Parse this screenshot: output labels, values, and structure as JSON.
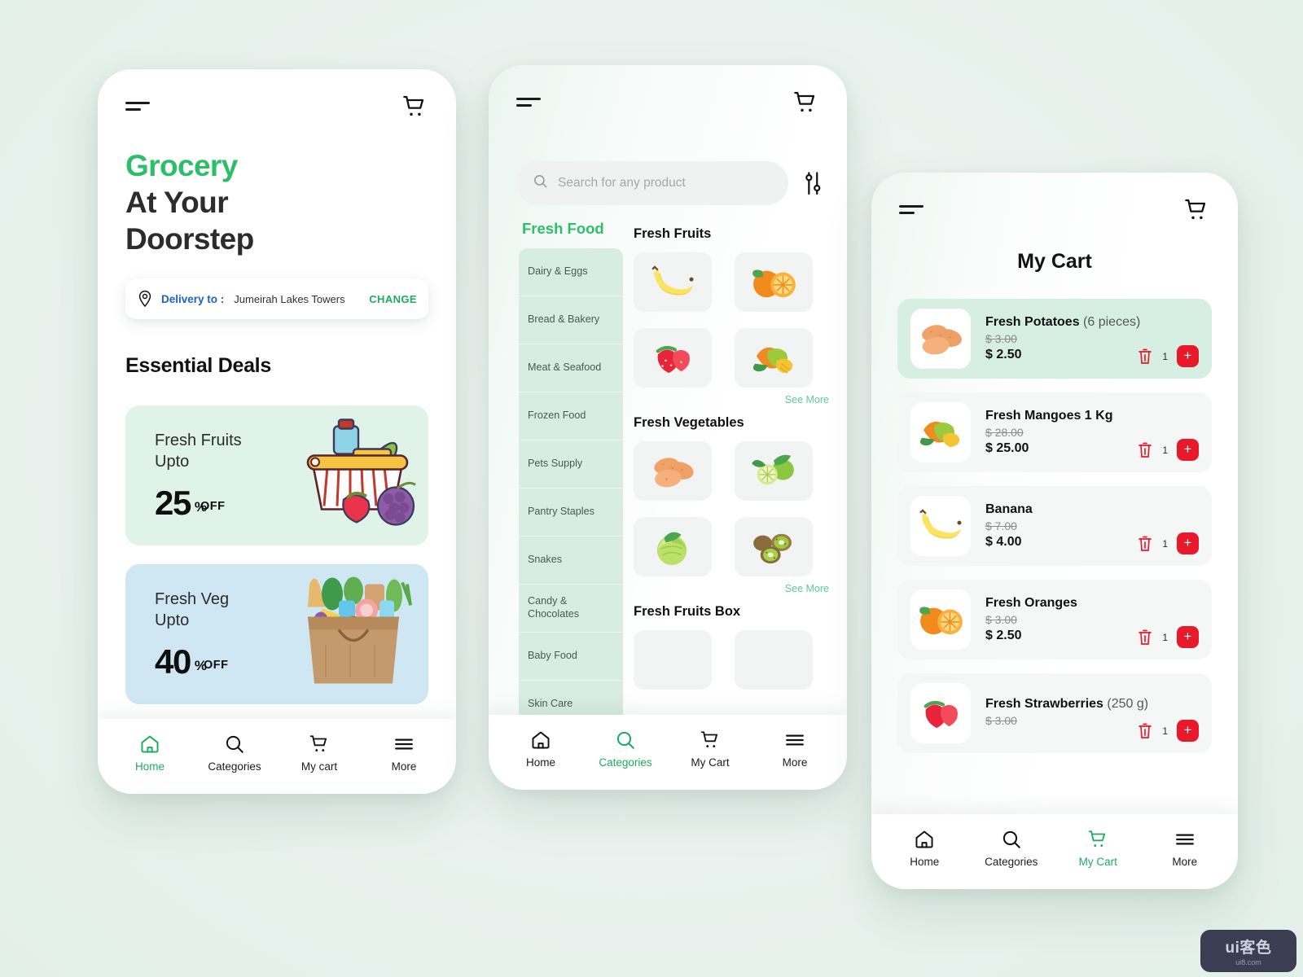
{
  "background_color": "#e9f2ee",
  "accent_green": "#2dbe68",
  "accent_blue": "#1a63c4",
  "accent_red": "#e8192a",
  "home_screen": {
    "menu_icon": "hamburger-menu-icon",
    "cart_icon": "shopping-cart-icon",
    "title_line1": "Grocery",
    "title_line2": "At Your",
    "title_line3": "Doorstep",
    "delivery": {
      "pin_icon": "location-pin-icon",
      "label": "Delivery to :",
      "address": "Jumeirah Lakes Towers",
      "change_label": "CHANGE"
    },
    "deals_title": "Essential Deals",
    "deals": [
      {
        "name_line1": "Fresh Fruits",
        "name_line2": "Upto",
        "percent": "25",
        "symbol": "%",
        "off": "OFF",
        "bg": "#dff3e8",
        "art": "grocery-basket-icon"
      },
      {
        "name_line1": "Fresh Veg",
        "name_line2": "Upto",
        "percent": "40",
        "symbol": "%",
        "off": "OFF",
        "bg": "#cfe7f3",
        "art": "grocery-bag-icon"
      }
    ],
    "nav": [
      {
        "label": "Home",
        "icon": "home-icon",
        "active": true
      },
      {
        "label": "Categories",
        "icon": "search-icon",
        "active": false
      },
      {
        "label": "My cart",
        "icon": "shopping-cart-icon",
        "active": false
      },
      {
        "label": "More",
        "icon": "hamburger-menu-icon",
        "active": false
      }
    ]
  },
  "categories_screen": {
    "menu_icon": "hamburger-menu-icon",
    "cart_icon": "shopping-cart-icon",
    "search": {
      "placeholder": "Search for any product",
      "value": "",
      "icon": "search-icon"
    },
    "filter_icon": "filter-sliders-icon",
    "active_tab": "Fresh Food",
    "categories": [
      "Dairy & Eggs",
      "Bread & Bakery",
      "Meat & Seafood",
      "Frozen Food",
      "Pets Supply",
      "Pantry Staples",
      "Snakes",
      "Candy & Chocolates",
      "Baby Food",
      "Skin Care"
    ],
    "sections": [
      {
        "title": "Fresh Fruits",
        "see_more": "See More",
        "items": [
          "banana-icon",
          "orange-icon",
          "strawberry-icon",
          "mango-icon"
        ]
      },
      {
        "title": "Fresh Vegetables",
        "see_more": "See More",
        "items": [
          "potato-icon",
          "lime-icon",
          "cabbage-icon",
          "kiwi-icon"
        ]
      },
      {
        "title": "Fresh Fruits Box",
        "see_more": "",
        "items": [
          "fruit-box-icon",
          "fruit-box-icon"
        ]
      }
    ],
    "nav": [
      {
        "label": "Home",
        "icon": "home-icon",
        "active": false
      },
      {
        "label": "Categories",
        "icon": "search-icon",
        "active": true
      },
      {
        "label": "My Cart",
        "icon": "shopping-cart-icon",
        "active": false
      },
      {
        "label": "More",
        "icon": "hamburger-menu-icon",
        "active": false
      }
    ]
  },
  "cart_screen": {
    "menu_icon": "hamburger-menu-icon",
    "cart_icon": "shopping-cart-icon",
    "title": "My Cart",
    "items": [
      {
        "name": "Fresh Potatoes",
        "qty_text": "(6 pieces)",
        "old_price": "$ 3.00",
        "price": "$ 2.50",
        "quantity": "1",
        "thumb": "potato-icon",
        "highlight": true
      },
      {
        "name": "Fresh Mangoes 1 Kg",
        "qty_text": "",
        "old_price": "$ 28.00",
        "price": "$ 25.00",
        "quantity": "1",
        "thumb": "mango-icon",
        "highlight": false
      },
      {
        "name": "Banana",
        "qty_text": "",
        "old_price": "$ 7.00",
        "price": "$ 4.00",
        "quantity": "1",
        "thumb": "banana-icon",
        "highlight": false
      },
      {
        "name": "Fresh Oranges",
        "qty_text": "",
        "old_price": "$ 3.00",
        "price": "$ 2.50",
        "quantity": "1",
        "thumb": "orange-icon",
        "highlight": false
      },
      {
        "name": "Fresh Strawberries",
        "qty_text": "(250 g)",
        "old_price": "$ 3.00",
        "price": "",
        "quantity": "1",
        "thumb": "strawberry-icon",
        "highlight": false
      }
    ],
    "delete_icon": "trash-icon",
    "add_icon": "plus-icon",
    "nav": [
      {
        "label": "Home",
        "icon": "home-icon",
        "active": false
      },
      {
        "label": "Categories",
        "icon": "search-icon",
        "active": false
      },
      {
        "label": "My Cart",
        "icon": "shopping-cart-icon",
        "active": true
      },
      {
        "label": "More",
        "icon": "hamburger-menu-icon",
        "active": false
      }
    ]
  },
  "watermark": {
    "main": "ui客色",
    "sub": "ui8.com"
  }
}
